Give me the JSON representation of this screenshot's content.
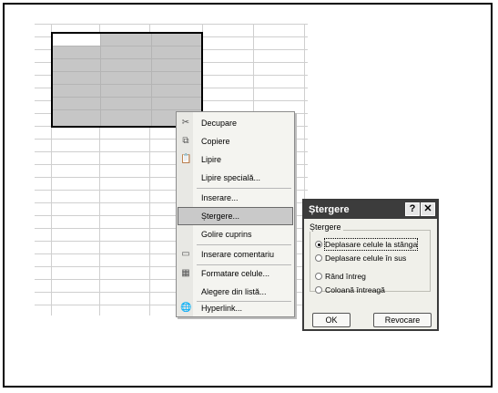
{
  "context_menu": {
    "items": [
      {
        "label": "Decupare",
        "icon": "scissors-icon"
      },
      {
        "label": "Copiere",
        "icon": "copy-icon"
      },
      {
        "label": "Lipire",
        "icon": "paste-icon"
      },
      {
        "label": "Lipire specială...",
        "icon": ""
      },
      {
        "label": "Inserare...",
        "icon": ""
      },
      {
        "label": "Ștergere...",
        "icon": ""
      },
      {
        "label": "Golire cuprins",
        "icon": ""
      },
      {
        "label": "Inserare comentariu",
        "icon": "comment-icon"
      },
      {
        "label": "Formatare celule...",
        "icon": "format-cells-icon"
      },
      {
        "label": "Alegere din listă...",
        "icon": ""
      },
      {
        "label": "Hyperlink...",
        "icon": "hyperlink-icon"
      }
    ],
    "highlighted_index": 5
  },
  "dialog": {
    "title": "Ștergere",
    "help_label": "?",
    "close_label": "✕",
    "group_label": "Ștergere",
    "options": [
      "Deplasare celule la stânga",
      "Deplasare celule în sus",
      "Rând întreg",
      "Coloană întreagă"
    ],
    "selected_index": 0,
    "ok_label": "OK",
    "cancel_label": "Revocare"
  }
}
